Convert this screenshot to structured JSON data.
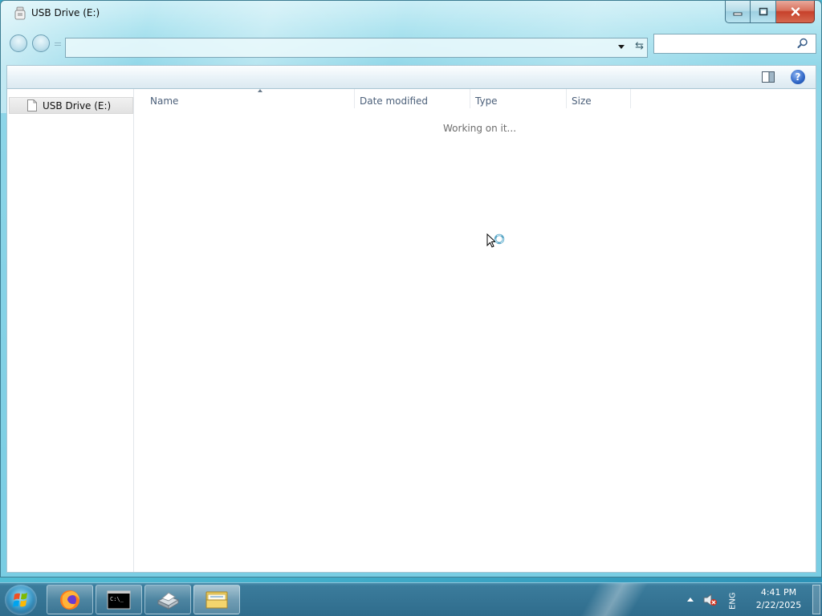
{
  "window": {
    "title": "USB Drive (E:)"
  },
  "address": {
    "path": "",
    "search_placeholder": ""
  },
  "help": {
    "glyph": "?"
  },
  "navigation": {
    "items": [
      {
        "label": "USB Drive (E:)",
        "icon": "drive-icon"
      }
    ]
  },
  "file_list": {
    "columns": [
      {
        "label": "Name"
      },
      {
        "label": "Date modified"
      },
      {
        "label": "Type"
      },
      {
        "label": "Size"
      }
    ],
    "status": "Working on it..."
  },
  "taskbar": {
    "apps": [
      {
        "name": "Firefox",
        "icon": "firefox-icon"
      },
      {
        "name": "Command Prompt",
        "icon": "cmd-icon"
      },
      {
        "name": "Scanner",
        "icon": "scanner-icon"
      },
      {
        "name": "Windows Explorer",
        "icon": "folder-icon"
      }
    ],
    "language": "ENG",
    "time": "4:41 PM",
    "date": "2/22/2025"
  },
  "colors": {
    "window_frame": "#79cde3",
    "close_button": "#c7402a",
    "taskbar": "#2f6c8c"
  }
}
